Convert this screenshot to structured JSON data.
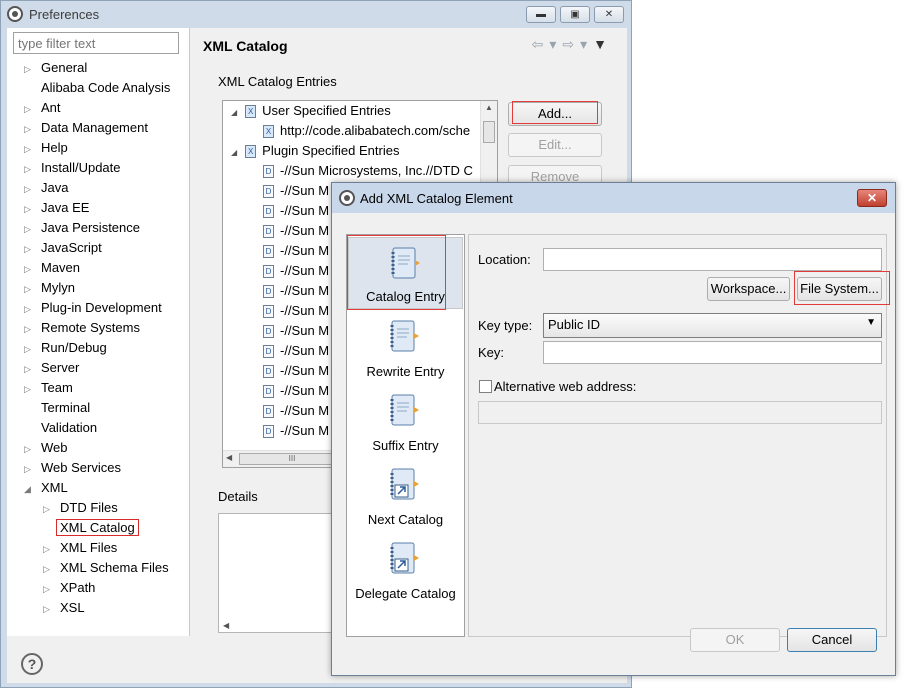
{
  "window": {
    "title": "Preferences"
  },
  "filter": {
    "placeholder": "type filter text"
  },
  "tree": [
    {
      "label": "General",
      "expander": "▷"
    },
    {
      "label": "Alibaba Code Analysis",
      "expander": ""
    },
    {
      "label": "Ant",
      "expander": "▷"
    },
    {
      "label": "Data Management",
      "expander": "▷"
    },
    {
      "label": "Help",
      "expander": "▷"
    },
    {
      "label": "Install/Update",
      "expander": "▷"
    },
    {
      "label": "Java",
      "expander": "▷"
    },
    {
      "label": "Java EE",
      "expander": "▷"
    },
    {
      "label": "Java Persistence",
      "expander": "▷"
    },
    {
      "label": "JavaScript",
      "expander": "▷"
    },
    {
      "label": "Maven",
      "expander": "▷"
    },
    {
      "label": "Mylyn",
      "expander": "▷"
    },
    {
      "label": "Plug-in Development",
      "expander": "▷"
    },
    {
      "label": "Remote Systems",
      "expander": "▷"
    },
    {
      "label": "Run/Debug",
      "expander": "▷"
    },
    {
      "label": "Server",
      "expander": "▷"
    },
    {
      "label": "Team",
      "expander": "▷"
    },
    {
      "label": "Terminal",
      "expander": ""
    },
    {
      "label": "Validation",
      "expander": ""
    },
    {
      "label": "Web",
      "expander": "▷"
    },
    {
      "label": "Web Services",
      "expander": "▷"
    },
    {
      "label": "XML",
      "expander": "◢"
    },
    {
      "label": "DTD Files",
      "expander": "▷"
    },
    {
      "label": "XML Catalog",
      "expander": ""
    },
    {
      "label": "XML Files",
      "expander": "▷"
    },
    {
      "label": "XML Schema Files",
      "expander": "▷"
    },
    {
      "label": "XPath",
      "expander": "▷"
    },
    {
      "label": "XSL",
      "expander": "▷"
    }
  ],
  "page": {
    "title": "XML Catalog",
    "group_label": "XML Catalog Entries",
    "details_label": "Details",
    "buttons": {
      "add": "Add...",
      "edit": "Edit...",
      "remove": "Remove"
    },
    "entries": [
      {
        "label": "User Specified Entries",
        "icon": "X"
      },
      {
        "label": "http://code.alibabatech.com/sche",
        "icon": "X"
      },
      {
        "label": "Plugin Specified Entries",
        "icon": "X"
      },
      {
        "label": "-//Sun Microsystems, Inc.//DTD C",
        "icon": "D"
      },
      {
        "label": "-//Sun M",
        "icon": "D"
      },
      {
        "label": "-//Sun M",
        "icon": "D"
      },
      {
        "label": "-//Sun M",
        "icon": "D"
      },
      {
        "label": "-//Sun M",
        "icon": "D"
      },
      {
        "label": "-//Sun M",
        "icon": "D"
      },
      {
        "label": "-//Sun M",
        "icon": "D"
      },
      {
        "label": "-//Sun M",
        "icon": "D"
      },
      {
        "label": "-//Sun M",
        "icon": "D"
      },
      {
        "label": "-//Sun M",
        "icon": "D"
      },
      {
        "label": "-//Sun M",
        "icon": "D"
      },
      {
        "label": "-//Sun M",
        "icon": "D"
      },
      {
        "label": "-//Sun M",
        "icon": "D"
      },
      {
        "label": "-//Sun M",
        "icon": "D"
      }
    ],
    "hscroll_thumb": "III"
  },
  "dialog": {
    "title": "Add XML Catalog Element",
    "close": "✕",
    "categories": [
      {
        "label": "Catalog Entry",
        "icon": "catalog-entry-icon"
      },
      {
        "label": "Rewrite Entry",
        "icon": "rewrite-entry-icon"
      },
      {
        "label": "Suffix Entry",
        "icon": "suffix-entry-icon"
      },
      {
        "label": "Next Catalog",
        "icon": "next-catalog-icon"
      },
      {
        "label": "Delegate Catalog",
        "icon": "delegate-catalog-icon"
      }
    ],
    "location_label": "Location:",
    "location_value": "",
    "workspace_button": "Workspace...",
    "filesystem_button": "File System...",
    "keytype_label": "Key type:",
    "keytype_value": "Public ID",
    "key_label": "Key:",
    "key_value": "",
    "alt_label": "Alternative web address:",
    "alt_value": "",
    "ok": "OK",
    "cancel": "Cancel"
  },
  "colors": {
    "highlight": "#e23b3b",
    "title_bar": "#c8d8ea"
  }
}
